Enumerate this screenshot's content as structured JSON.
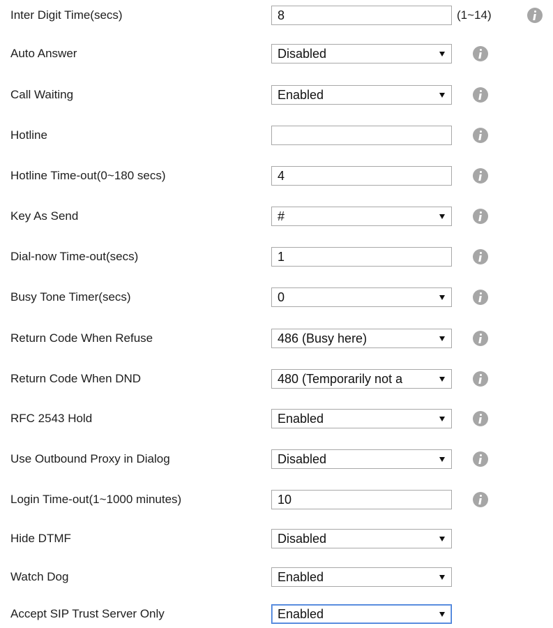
{
  "rows": [
    {
      "label": "Inter Digit Time(secs)",
      "type": "input",
      "value": "8",
      "range": "(1~14)",
      "info": true
    },
    {
      "label": "Auto Answer",
      "type": "select",
      "value": "Disabled",
      "info": true
    },
    {
      "label": "Call Waiting",
      "type": "select",
      "value": "Enabled",
      "info": true
    },
    {
      "label": "Hotline",
      "type": "input",
      "value": "",
      "info": true
    },
    {
      "label": "Hotline Time-out(0~180 secs)",
      "type": "input",
      "value": "4",
      "info": true
    },
    {
      "label": "Key As Send",
      "type": "select",
      "value": "#",
      "info": true
    },
    {
      "label": "Dial-now Time-out(secs)",
      "type": "input",
      "value": "1",
      "info": true
    },
    {
      "label": "Busy Tone Timer(secs)",
      "type": "select",
      "value": "0",
      "info": true
    },
    {
      "label": "Return Code When Refuse",
      "type": "select",
      "value": "486 (Busy here)",
      "info": true
    },
    {
      "label": "Return Code When DND",
      "type": "select",
      "value": "480 (Temporarily not a",
      "info": true
    },
    {
      "label": "RFC 2543 Hold",
      "type": "select",
      "value": "Enabled",
      "info": true
    },
    {
      "label": "Use Outbound Proxy in Dialog",
      "type": "select",
      "value": "Disabled",
      "info": true
    },
    {
      "label": "Login Time-out(1~1000 minutes)",
      "type": "input",
      "value": "10",
      "info": true
    },
    {
      "label": "Hide DTMF",
      "type": "select",
      "value": "Disabled",
      "info": false
    },
    {
      "label": "Watch Dog",
      "type": "select",
      "value": "Enabled",
      "info": false
    },
    {
      "label": "Accept SIP Trust Server Only",
      "type": "select",
      "value": "Enabled",
      "info": false
    }
  ],
  "icons": {
    "info": "info-icon",
    "dropdown": "dropdown-arrow-icon"
  },
  "colors": {
    "info_icon": "#a6a6a6",
    "focus_border": "#3b78d8",
    "field_border": "#a8a8a8"
  }
}
